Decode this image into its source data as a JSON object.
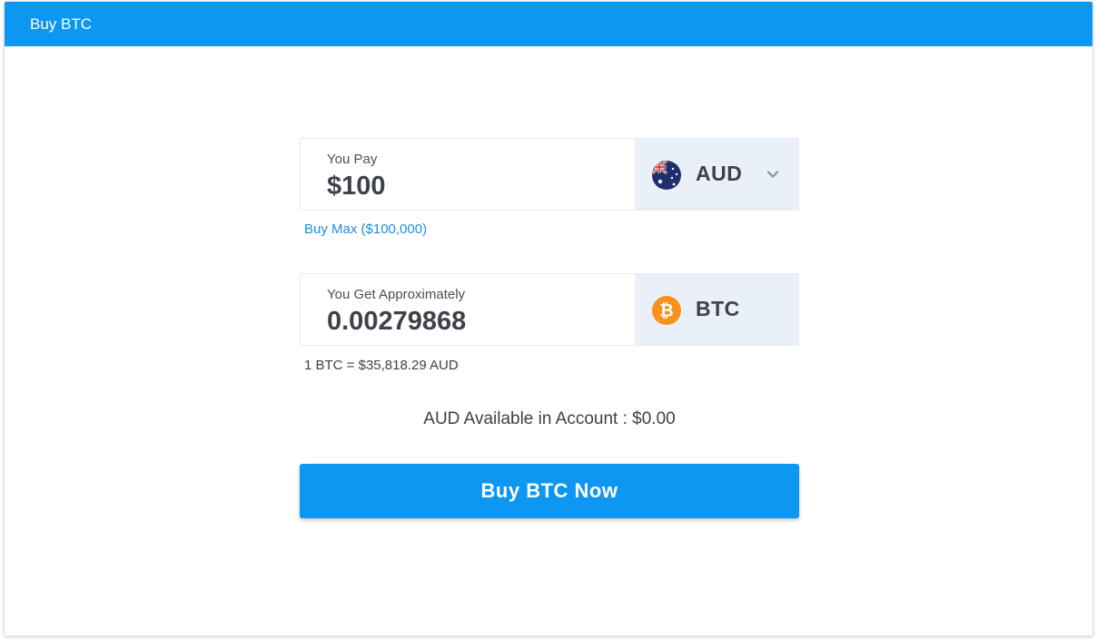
{
  "header": {
    "title": "Buy BTC"
  },
  "pay": {
    "label": "You Pay",
    "value": "$100",
    "currency_code": "AUD",
    "currency_icon": "australia-flag-icon"
  },
  "buy_max_label": "Buy Max ($100,000)",
  "get": {
    "label": "You Get Approximately",
    "value": "0.00279868",
    "currency_code": "BTC",
    "currency_icon": "bitcoin-icon"
  },
  "rate_text": "1 BTC = $35,818.29 AUD",
  "available_text": "AUD Available in Account : $0.00",
  "buy_button_label": "Buy BTC Now",
  "colors": {
    "accent": "#0d96f2",
    "link": "#1c8fe0",
    "currency_bg": "#eaf0f7",
    "bitcoin": "#f7931a"
  }
}
